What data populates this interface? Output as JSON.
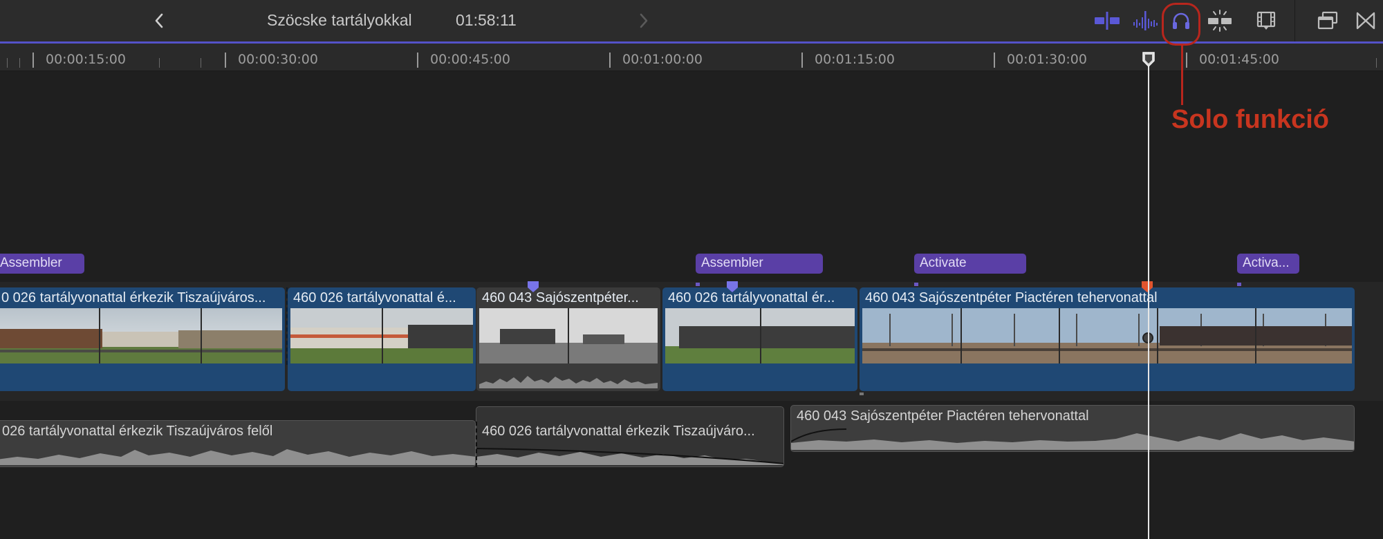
{
  "window": {
    "title": "Szöcske tartályokkal",
    "duration": "01:58:11"
  },
  "colors": {
    "accent": "#5452c8",
    "title_clip": "#5a3fa6",
    "video_clip": "#1f4874",
    "annotation": "#c8351f",
    "playhead": "#e6e6e6"
  },
  "icons": {
    "back": "chevron-left-icon",
    "forward": "chevron-right-icon",
    "skimming": "video-skimming-icon",
    "audio_skimming": "audio-skimming-icon",
    "solo": "headphones-icon",
    "snapping": "snapping-icon",
    "clip_appearance": "filmstrip-icon",
    "effects": "window-stack-icon",
    "transitions": "bowtie-icon"
  },
  "ruler": {
    "labels": [
      "00:00:15:00",
      "00:00:30:00",
      "00:00:45:00",
      "00:01:00:00",
      "00:01:15:00",
      "00:01:30:00",
      "00:01:45:00"
    ]
  },
  "annotation": {
    "label": "Solo funkció"
  },
  "title_clips": [
    {
      "label": "Assembler"
    },
    {
      "label": "Assembler"
    },
    {
      "label": "Activate"
    },
    {
      "label": "Activa..."
    }
  ],
  "video_clips": [
    {
      "label": "0 026 tartályvonattal érkezik Tiszaújváros..."
    },
    {
      "label": "460 026 tartályvonattal é..."
    },
    {
      "label": "460 043 Sajószentpéter..."
    },
    {
      "label": "460 026 tartályvonattal ér..."
    },
    {
      "label": "460 043 Sajószentpéter Piactéren tehervonattal"
    }
  ],
  "audio_clips": [
    {
      "label": "026 tartályvonattal érkezik Tiszaújváros felől"
    },
    {
      "label": "460 026 tartályvonattal érkezik Tiszaújváro..."
    },
    {
      "label": "460 043 Sajószentpéter Piactéren tehervonattal"
    }
  ]
}
